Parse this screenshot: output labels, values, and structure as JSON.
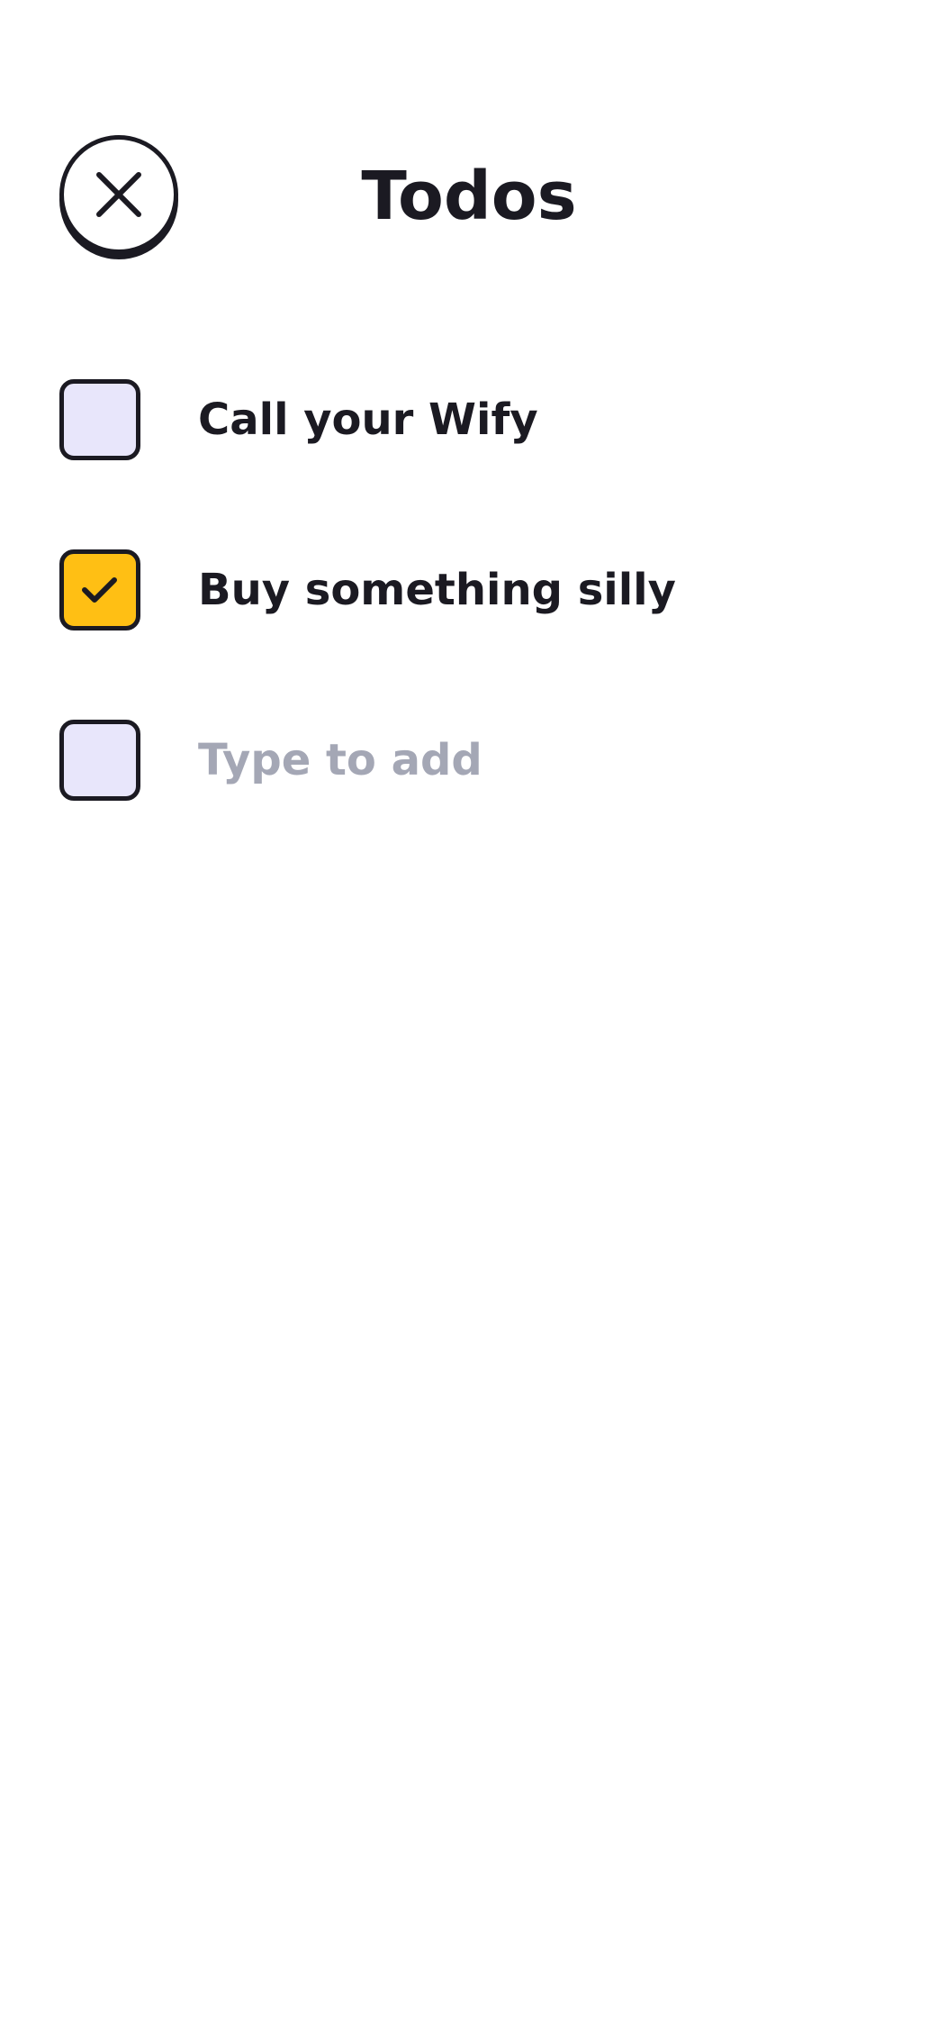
{
  "header": {
    "title": "Todos",
    "close_icon": "close-icon"
  },
  "todos": [
    {
      "label": "Call your Wify",
      "checked": false
    },
    {
      "label": "Buy something silly",
      "checked": true
    }
  ],
  "new_todo": {
    "value": "",
    "placeholder": "Type to add",
    "checked": false
  },
  "colors": {
    "text": "#1b1a22",
    "checkbox_unchecked": "#e8e6fb",
    "checkbox_checked": "#ffbf14",
    "placeholder": "#a4a7b5",
    "background": "#ffffff"
  },
  "icons": {
    "checked": "checkmark-icon"
  }
}
